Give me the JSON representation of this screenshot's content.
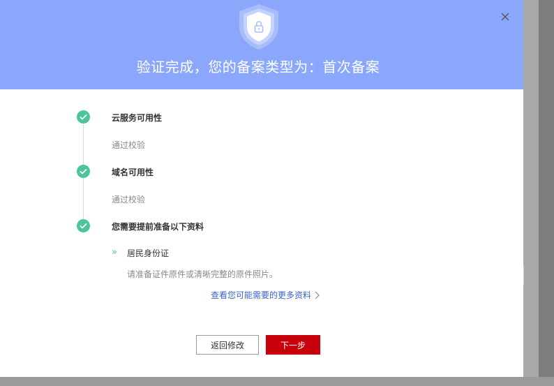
{
  "header": {
    "title": "验证完成，您的备案类型为：首次备案"
  },
  "steps": [
    {
      "title": "云服务可用性",
      "desc": "通过校验"
    },
    {
      "title": "域名可用性",
      "desc": "通过校验"
    },
    {
      "title": "您需要提前准备以下资料"
    }
  ],
  "documents": {
    "arrow": "»",
    "name": "居民身份证",
    "desc": "请准备证件原件或清晰完整的原件照片。",
    "more_link": "查看您可能需要的更多资料"
  },
  "buttons": {
    "back": "返回修改",
    "next": "下一步"
  },
  "colors": {
    "header_bg": "#8aa7fc",
    "success_green": "#4bc59a",
    "primary_red": "#c7000b",
    "link_blue": "#3f62c9"
  },
  "icons": {
    "shield": "shield-lock-icon",
    "close": "close-icon",
    "check": "check-icon",
    "chevron": "chevron-right-icon"
  }
}
